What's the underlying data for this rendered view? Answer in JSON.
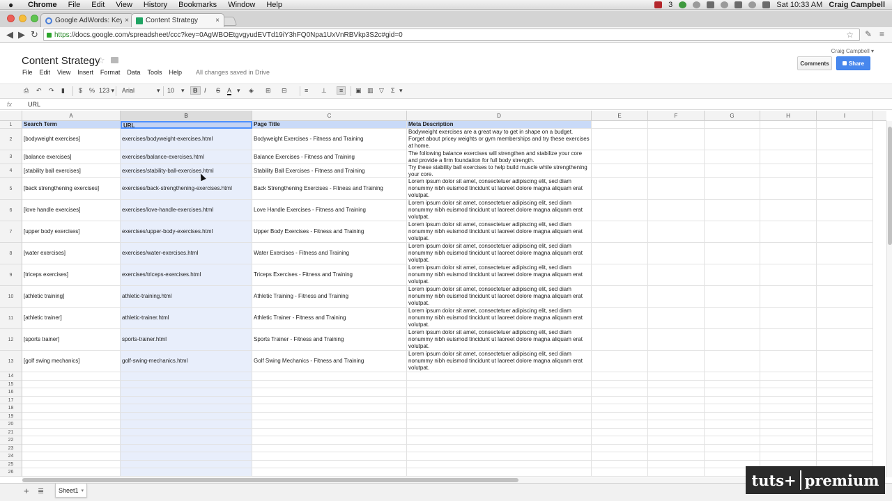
{
  "os_menu": {
    "app_name": "Chrome",
    "items": [
      "File",
      "Edit",
      "View",
      "History",
      "Bookmarks",
      "Window",
      "Help"
    ],
    "status_badge": "3",
    "clock": "Sat 10:33 AM",
    "user": "Craig Campbell"
  },
  "browser": {
    "tabs": [
      {
        "title": "Google AdWords: Keyword",
        "close": "×",
        "favicon": "google-icon"
      },
      {
        "title": "Content Strategy",
        "close": "×",
        "favicon": "sheets-icon"
      }
    ],
    "url_secure": "https",
    "url_rest": "://docs.google.com/spreadsheet/ccc?key=0AgWBOEtgvgyudEVTd19iY3hFQ0Npa1UxVnRBVkp3S2c#gid=0",
    "star_glyph": "☆"
  },
  "doc": {
    "title": "Content Strategy",
    "star_glyph": "☆",
    "user": "Craig Campbell ▾",
    "comments_label": "Comments",
    "share_label": "Share",
    "menus": [
      "File",
      "Edit",
      "View",
      "Insert",
      "Format",
      "Data",
      "Tools",
      "Help"
    ],
    "save_status": "All changes saved in Drive"
  },
  "toolbar": {
    "currency": "$",
    "percent": "%",
    "number_format": "123 ▾",
    "font": "Arial",
    "font_size": "10",
    "bold": "B",
    "italic": "I",
    "strike": "S",
    "text_color": "A",
    "sigma": "Σ"
  },
  "formula_bar": {
    "label": "fx",
    "value": "URL"
  },
  "grid": {
    "columns": [
      "A",
      "B",
      "C",
      "D",
      "E",
      "F",
      "G",
      "H",
      "I"
    ],
    "selected_column": "B",
    "header_row": {
      "a": "Search Term",
      "b": "URL",
      "c": "Page Title",
      "d": "Meta Description"
    },
    "rows": [
      {
        "n": "2",
        "a": "[bodyweight exercises]",
        "b": "exercises/bodyweight-exercises.html",
        "c": "Bodyweight Exercises - Fitness and Training",
        "d": "Bodyweight exercises are a great way to get in shape on a budget. Forget about pricey weights or gym memberships and try these exercises at home."
      },
      {
        "n": "3",
        "a": "[balance exercises]",
        "b": "exercises/balance-exercises.html",
        "c": "Balance Exercises - Fitness and Training",
        "d": "The following balance exercises will strengthen and stabilize your core and provide a firm foundation for full body strength."
      },
      {
        "n": "4",
        "a": "[stability ball exercises]",
        "b": "exercises/stability-ball-exercises.html",
        "c": "Stability Ball Exercises - Fitness and Training",
        "d": "Try these stability ball exercises to help build muscle while strengthening your core."
      },
      {
        "n": "5",
        "a": "[back strengthening exercises]",
        "b": "exercises/back-strengthening-exercises.html",
        "c": "Back Strengthening Exercises - Fitness and Training",
        "d": "Lorem ipsum dolor sit amet, consectetuer adipiscing elit, sed diam nonummy nibh euismod tincidunt ut laoreet dolore magna aliquam erat volutpat."
      },
      {
        "n": "6",
        "a": "[love handle exercises]",
        "b": "exercises/love-handle-exercises.html",
        "c": "Love Handle Exercises - Fitness and Training",
        "d": "Lorem ipsum dolor sit amet, consectetuer adipiscing elit, sed diam nonummy nibh euismod tincidunt ut laoreet dolore magna aliquam erat volutpat."
      },
      {
        "n": "7",
        "a": "[upper body exercises]",
        "b": "exercises/upper-body-exercises.html",
        "c": "Upper Body Exercises - Fitness and Training",
        "d": "Lorem ipsum dolor sit amet, consectetuer adipiscing elit, sed diam nonummy nibh euismod tincidunt ut laoreet dolore magna aliquam erat volutpat."
      },
      {
        "n": "8",
        "a": "[water exercises]",
        "b": "exercises/water-exercises.html",
        "c": "Water Exercises - Fitness and Training",
        "d": "Lorem ipsum dolor sit amet, consectetuer adipiscing elit, sed diam nonummy nibh euismod tincidunt ut laoreet dolore magna aliquam erat volutpat."
      },
      {
        "n": "9",
        "a": "[triceps exercises]",
        "b": "exercises/triceps-exercises.html",
        "c": "Triceps Exercises - Fitness and Training",
        "d": "Lorem ipsum dolor sit amet, consectetuer adipiscing elit, sed diam nonummy nibh euismod tincidunt ut laoreet dolore magna aliquam erat volutpat."
      },
      {
        "n": "10",
        "a": "[athletic training]",
        "b": "athletic-training.html",
        "c": "Athletic Training - Fitness and Training",
        "d": "Lorem ipsum dolor sit amet, consectetuer adipiscing elit, sed diam nonummy nibh euismod tincidunt ut laoreet dolore magna aliquam erat volutpat."
      },
      {
        "n": "11",
        "a": "[athletic trainer]",
        "b": "athletic-trainer.html",
        "c": "Athletic Trainer - Fitness and Training",
        "d": "Lorem ipsum dolor sit amet, consectetuer adipiscing elit, sed diam nonummy nibh euismod tincidunt ut laoreet dolore magna aliquam erat volutpat."
      },
      {
        "n": "12",
        "a": "[sports trainer]",
        "b": "sports-trainer.html",
        "c": "Sports Trainer - Fitness and Training",
        "d": "Lorem ipsum dolor sit amet, consectetuer adipiscing elit, sed diam nonummy nibh euismod tincidunt ut laoreet dolore magna aliquam erat volutpat."
      },
      {
        "n": "13",
        "a": "[golf swing mechanics]",
        "b": "golf-swing-mechanics.html",
        "c": "Golf Swing Mechanics - Fitness and Training",
        "d": "Lorem ipsum dolor sit amet, consectetuer adipiscing elit, sed diam nonummy nibh euismod tincidunt ut laoreet dolore magna aliquam erat volutpat."
      }
    ],
    "empty_rows": [
      "14",
      "15",
      "16",
      "17",
      "18",
      "19",
      "20",
      "21",
      "22",
      "23",
      "24",
      "25",
      "26"
    ]
  },
  "sheets": {
    "add_glyph": "+",
    "list_glyph": "≣",
    "tabs": [
      "Sheet1"
    ],
    "dropdown_glyph": "▾"
  },
  "watermark": {
    "left": "tuts+",
    "right": "premium"
  },
  "colors": {
    "header_fill": "#c9daf8",
    "selection": "#4d90fe",
    "share_button": "#4787ed"
  }
}
